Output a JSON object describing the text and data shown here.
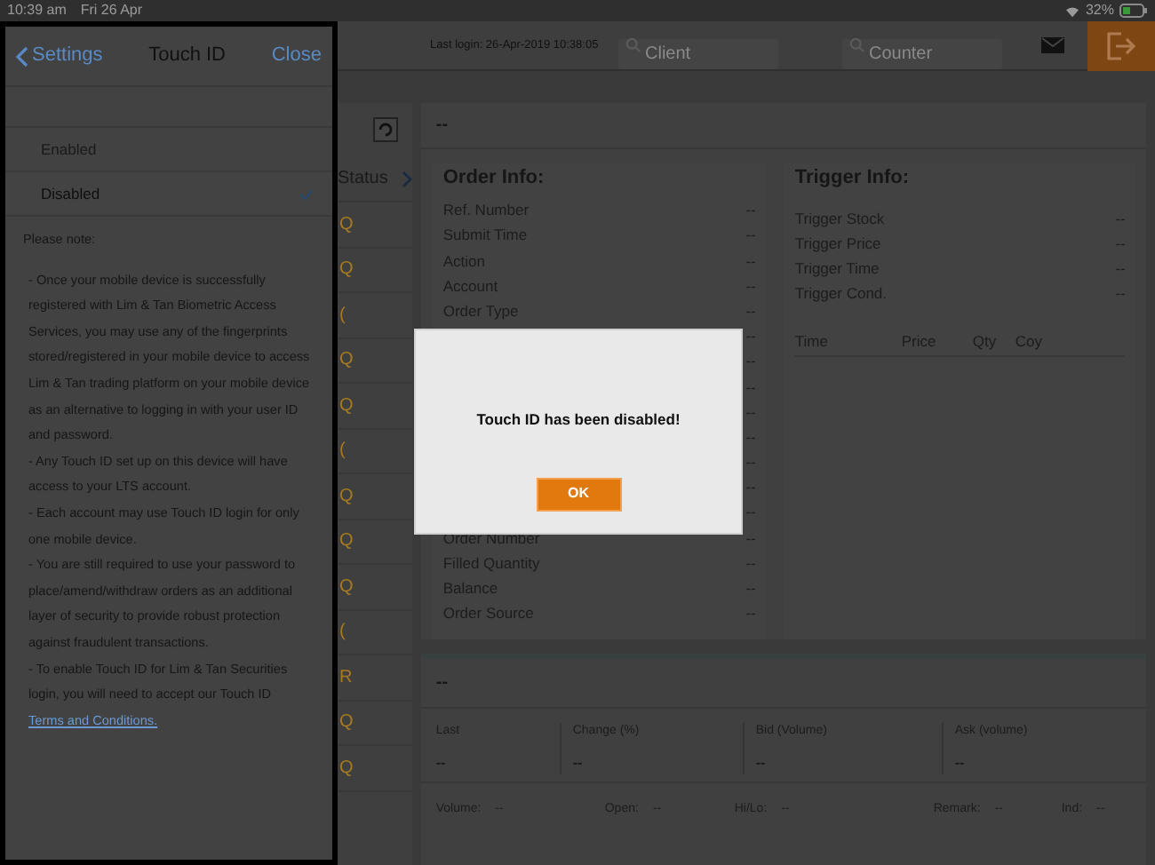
{
  "status_bar": {
    "time": "10:39 am",
    "date": "Fri 26 Apr",
    "battery": "32%"
  },
  "header": {
    "last_login": "Last login: 26-Apr-2019 10:38:05",
    "search_fields": [
      {
        "placeholder": "Client"
      },
      {
        "placeholder": "Counter"
      }
    ]
  },
  "order_list": {
    "column_heading": "Status",
    "rows": [
      {
        "text": "Q"
      },
      {
        "text": "Q"
      },
      {
        "text": "("
      },
      {
        "text": "Q"
      },
      {
        "text": "Q"
      },
      {
        "text": "("
      },
      {
        "text": "Q"
      },
      {
        "text": "Q"
      },
      {
        "text": "Q"
      },
      {
        "text": "("
      },
      {
        "text": "R"
      },
      {
        "text": "Q"
      },
      {
        "text": "Q"
      }
    ]
  },
  "order_panel": {
    "title": "--",
    "order_info": {
      "title": "Order Info:",
      "rows": [
        {
          "label": "Ref. Number",
          "value": "--"
        },
        {
          "label": "Submit Time",
          "value": "--"
        },
        {
          "label": "Action",
          "value": "--"
        },
        {
          "label": "Account",
          "value": "--"
        },
        {
          "label": "Order Type",
          "value": "--"
        },
        {
          "value": "--"
        },
        {
          "value": "--"
        },
        {
          "value": "--"
        },
        {
          "value": "--"
        },
        {
          "value": "--"
        },
        {
          "value": "--"
        },
        {
          "value": "--"
        },
        {
          "value": "--"
        },
        {
          "label": "Order Number",
          "value": "--"
        },
        {
          "label": "Filled Quantity",
          "value": "--"
        },
        {
          "label": "Balance",
          "value": "--"
        },
        {
          "label": "Order Source",
          "value": "--"
        }
      ]
    },
    "trigger_info": {
      "title": "Trigger Info:",
      "rows": [
        {
          "label": "Trigger Stock",
          "value": "--"
        },
        {
          "label": "Trigger Price",
          "value": "--"
        },
        {
          "label": "Trigger Time",
          "value": "--"
        },
        {
          "label": "Trigger Cond.",
          "value": "--"
        }
      ],
      "columns": [
        "Time",
        "Price",
        "Qty",
        "Coy"
      ]
    }
  },
  "quote_panel": {
    "title": "--",
    "fields": [
      {
        "label": "Last",
        "value": "--"
      },
      {
        "label": "Change (%)",
        "value": "--"
      },
      {
        "label": "Bid (Volume)",
        "value": "--"
      },
      {
        "label": "Ask (volume)",
        "value": "--"
      }
    ],
    "footer": [
      {
        "label": "Volume:",
        "value": "--"
      },
      {
        "label": "Open:",
        "value": "--"
      },
      {
        "label": "Hi/Lo:",
        "value": "--"
      },
      {
        "label": "Remark:",
        "value": "--"
      },
      {
        "label": "Ind:",
        "value": "--"
      }
    ]
  },
  "settings_popover": {
    "back": "Settings",
    "title": "Touch ID",
    "close": "Close",
    "options": [
      {
        "label": "Enabled",
        "selected": false
      },
      {
        "label": "Disabled",
        "selected": true
      }
    ],
    "note_title": "Please note:",
    "notes": [
      "- Once your mobile device is successfully registered with Lim & Tan Biometric Access Services, you may use any of the fingerprints stored/registered in your mobile device to access Lim & Tan trading platform on your mobile device as an alternative to logging in with your user ID and password.",
      "- Any Touch ID set up on this device will have access to your LTS account.",
      "- Each account may use Touch ID login for only one mobile device.",
      "- You are still required to use your password to place/amend/withdraw orders as an additional layer of security to provide robust protection against fraudulent transactions.",
      "- To enable Touch ID for Lim & Tan Securities login, you will need to accept our Touch ID"
    ],
    "link": "Terms and Conditions."
  },
  "dialog": {
    "message": "Touch ID has been disabled!",
    "button": "OK"
  }
}
